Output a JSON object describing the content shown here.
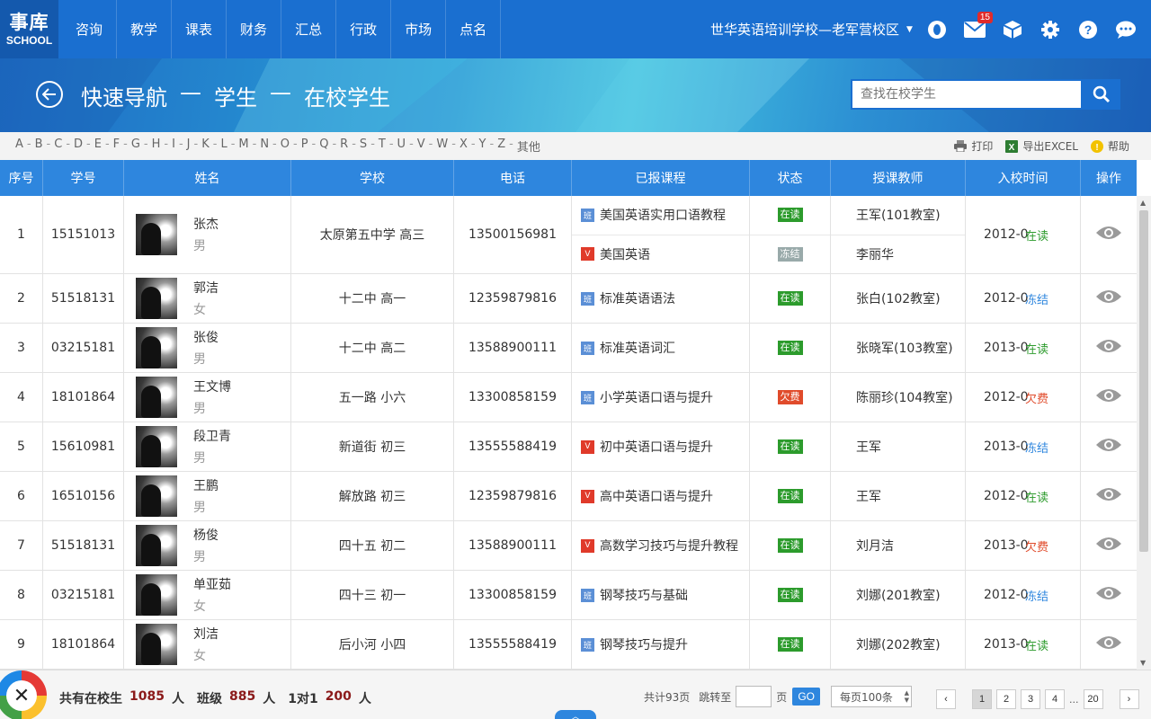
{
  "app": {
    "logo_zh": "事库",
    "logo_en": "SCHOOL",
    "nav": [
      "咨询",
      "教学",
      "课表",
      "财务",
      "汇总",
      "行政",
      "市场",
      "点名"
    ],
    "school_name": "世华英语培训学校—老军营校区",
    "mail_count": "15"
  },
  "banner": {
    "crumb1": "快速导航",
    "dash1": "—",
    "crumb2": "学生",
    "dash2": "—",
    "crumb3": "在校学生",
    "search_placeholder": "查找在校学生"
  },
  "alphabar": {
    "letters": [
      "A",
      "B",
      "C",
      "D",
      "E",
      "F",
      "G",
      "H",
      "I",
      "J",
      "K",
      "L",
      "M",
      "N",
      "O",
      "P",
      "Q",
      "R",
      "S",
      "T",
      "U",
      "V",
      "W",
      "X",
      "Y",
      "Z",
      "其他"
    ],
    "print": "打印",
    "export": "导出EXCEL",
    "help": "帮助"
  },
  "table": {
    "headers": [
      "序号",
      "学号",
      "姓名",
      "学校",
      "电话",
      "已报课程",
      "状态",
      "授课教师",
      "入校时间",
      "操作"
    ],
    "rows": [
      {
        "no": "1",
        "id": "15151013",
        "name": "张杰",
        "gender": "男",
        "school": "太原第五中学  高三",
        "phone": "13500156981",
        "courses": [
          {
            "tag": "班",
            "type": "ban",
            "name": "美国英语实用口语教程",
            "status": "在读",
            "scls": "g",
            "teacher": "王军(101教室)"
          },
          {
            "tag": "V",
            "type": "v",
            "name": "美国英语",
            "status": "冻结",
            "scls": "f",
            "teacher": "李丽华"
          }
        ],
        "date": "2012-0",
        "over": "在读",
        "ocls": "g"
      },
      {
        "no": "2",
        "id": "51518131",
        "name": "郭洁",
        "gender": "女",
        "school": "十二中  高一",
        "phone": "12359879816",
        "courses": [
          {
            "tag": "班",
            "type": "ban",
            "name": "标准英语语法",
            "status": "在读",
            "scls": "g",
            "teacher": "张白(102教室)"
          }
        ],
        "date": "2012-0",
        "over": "冻结",
        "ocls": "b"
      },
      {
        "no": "3",
        "id": "03215181",
        "name": "张俊",
        "gender": "男",
        "school": "十二中  高二",
        "phone": "13588900111",
        "courses": [
          {
            "tag": "班",
            "type": "ban",
            "name": "标准英语词汇",
            "status": "在读",
            "scls": "g",
            "teacher": "张晓军(103教室)"
          }
        ],
        "date": "2013-0",
        "over": "在读",
        "ocls": "g"
      },
      {
        "no": "4",
        "id": "18101864",
        "name": "王文博",
        "gender": "男",
        "school": "五一路  小六",
        "phone": "13300858159",
        "courses": [
          {
            "tag": "班",
            "type": "ban",
            "name": "小学英语口语与提升",
            "status": "欠费",
            "scls": "r",
            "teacher": "陈丽珍(104教室)"
          }
        ],
        "date": "2012-0",
        "over": "欠费",
        "ocls": "r"
      },
      {
        "no": "5",
        "id": "15610981",
        "name": "段卫青",
        "gender": "男",
        "school": "新道街  初三",
        "phone": "13555588419",
        "courses": [
          {
            "tag": "V",
            "type": "v",
            "name": "初中英语口语与提升",
            "status": "在读",
            "scls": "g",
            "teacher": "王军"
          }
        ],
        "date": "2013-0",
        "over": "冻结",
        "ocls": "b"
      },
      {
        "no": "6",
        "id": "16510156",
        "name": "王鹏",
        "gender": "男",
        "school": "解放路  初三",
        "phone": "12359879816",
        "courses": [
          {
            "tag": "V",
            "type": "v",
            "name": "高中英语口语与提升",
            "status": "在读",
            "scls": "g",
            "teacher": "王军"
          }
        ],
        "date": "2012-0",
        "over": "在读",
        "ocls": "g"
      },
      {
        "no": "7",
        "id": "51518131",
        "name": "杨俊",
        "gender": "男",
        "school": "四十五  初二",
        "phone": "13588900111",
        "courses": [
          {
            "tag": "V",
            "type": "v",
            "name": "高数学习技巧与提升教程",
            "status": "在读",
            "scls": "g",
            "teacher": "刘月洁"
          }
        ],
        "date": "2013-0",
        "over": "欠费",
        "ocls": "r"
      },
      {
        "no": "8",
        "id": "03215181",
        "name": "单亚茹",
        "gender": "女",
        "school": "四十三  初一",
        "phone": "13300858159",
        "courses": [
          {
            "tag": "班",
            "type": "ban",
            "name": "钢琴技巧与基础",
            "status": "在读",
            "scls": "g",
            "teacher": "刘娜(201教室)"
          }
        ],
        "date": "2012-0",
        "over": "冻结",
        "ocls": "b"
      },
      {
        "no": "9",
        "id": "18101864",
        "name": "刘洁",
        "gender": "女",
        "school": "后小河  小四",
        "phone": "13555588419",
        "courses": [
          {
            "tag": "班",
            "type": "ban",
            "name": "钢琴技巧与提升",
            "status": "在读",
            "scls": "g",
            "teacher": "刘娜(202教室)"
          }
        ],
        "date": "2013-0",
        "over": "在读",
        "ocls": "g"
      }
    ]
  },
  "footer": {
    "label_total": "共有在校生",
    "total": "1085",
    "unit1": "人",
    "label_class": "班级",
    "class_count": "885",
    "unit2": "人",
    "label_one": "1对1",
    "one_count": "200",
    "unit3": "人",
    "pages_total": "共计93页",
    "jump_label": "跳转至",
    "page_unit": "页",
    "go": "GO",
    "per_page": "每页100条",
    "pages": [
      "1",
      "2",
      "3",
      "4"
    ],
    "ellipsis": "...",
    "last_page": "20",
    "prev": "‹",
    "next": "›"
  }
}
